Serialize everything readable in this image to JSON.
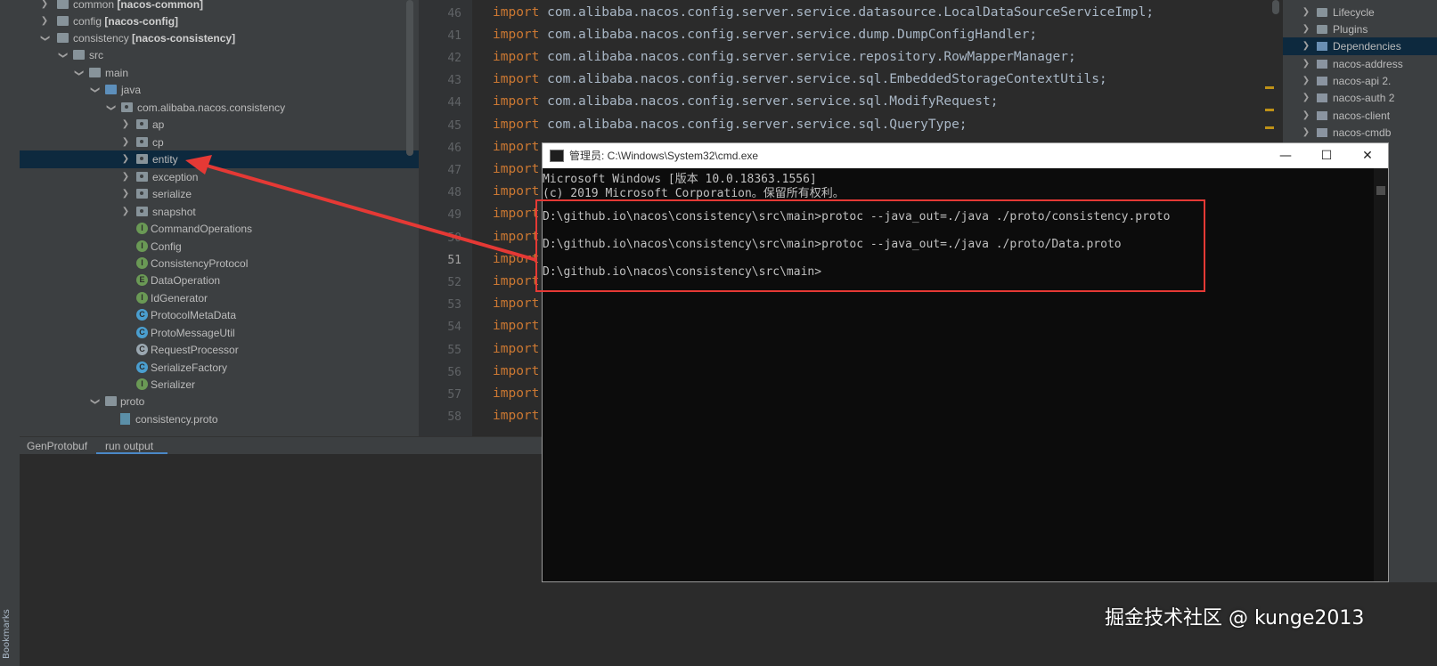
{
  "project_tree": {
    "rows": [
      {
        "name": "common",
        "suffix": "[nacos-common]"
      },
      {
        "name": "config",
        "suffix": "[nacos-config]"
      },
      {
        "name": "consistency",
        "suffix": "[nacos-consistency]"
      },
      {
        "name": "src"
      },
      {
        "name": "main"
      },
      {
        "name": "java"
      },
      {
        "name": "com.alibaba.nacos.consistency"
      },
      {
        "name": "ap"
      },
      {
        "name": "cp"
      },
      {
        "name": "entity"
      },
      {
        "name": "exception"
      },
      {
        "name": "serialize"
      },
      {
        "name": "snapshot"
      },
      {
        "name": "CommandOperations"
      },
      {
        "name": "Config"
      },
      {
        "name": "ConsistencyProtocol"
      },
      {
        "name": "DataOperation"
      },
      {
        "name": "IdGenerator"
      },
      {
        "name": "ProtocolMetaData"
      },
      {
        "name": "ProtoMessageUtil"
      },
      {
        "name": "RequestProcessor"
      },
      {
        "name": "SerializeFactory"
      },
      {
        "name": "Serializer"
      },
      {
        "name": "proto"
      },
      {
        "name": "consistency.proto"
      }
    ]
  },
  "editor": {
    "line_numbers": [
      "46",
      "41",
      "42",
      "43",
      "44",
      "45",
      "46",
      "47",
      "48",
      "49",
      "50",
      "51",
      "52",
      "53",
      "54",
      "55",
      "56",
      "57",
      "58"
    ],
    "keyword": "import",
    "lines": [
      "com.alibaba.nacos.config.server.service.datasource.LocalDataSourceServiceImpl;",
      "com.alibaba.nacos.config.server.service.dump.DumpConfigHandler;",
      "com.alibaba.nacos.config.server.service.repository.RowMapperManager;",
      "com.alibaba.nacos.config.server.service.sql.EmbeddedStorageContextUtils;",
      "com.alibaba.nacos.config.server.service.sql.ModifyRequest;",
      "com.alibaba.nacos.config.server.service.sql.QueryType;"
    ]
  },
  "right_panel": {
    "rows": [
      "Lifecycle",
      "Plugins",
      "Dependencies",
      "nacos-address",
      "nacos-api 2.",
      "nacos-auth 2",
      "nacos-client",
      "nacos-cmdb"
    ]
  },
  "run_panel": {
    "tabs": [
      "GenProtobuf",
      "run output"
    ]
  },
  "cmd": {
    "title": "管理员: C:\\Windows\\System32\\cmd.exe",
    "lines": [
      "Microsoft Windows [版本 10.0.18363.1556]",
      "(c) 2019 Microsoft Corporation。保留所有权利。",
      "",
      "D:\\github.io\\nacos\\consistency\\src\\main>protoc --java_out=./java ./proto/consistency.proto",
      "",
      "D:\\github.io\\nacos\\consistency\\src\\main>protoc --java_out=./java ./proto/Data.proto",
      "",
      "D:\\github.io\\nacos\\consistency\\src\\main>"
    ],
    "buttons": {
      "minimize": "—",
      "maximize": "☐",
      "close": "✕"
    }
  },
  "left_strip": {
    "bookmarks": "Bookmarks"
  },
  "watermark": "掘金技术社区 @ kunge2013",
  "colors": {
    "accent": "#4a88c7",
    "selection": "#0d293e",
    "annotation": "#e53935",
    "keyword": "#cc7832"
  }
}
